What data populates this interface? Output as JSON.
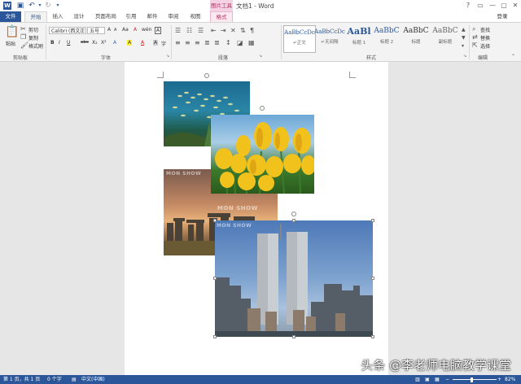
{
  "titlebar": {
    "doc_title": "文档1 - Word",
    "contextual_group": "图片工具",
    "minimize": "—",
    "restore": "▢",
    "close": "✕",
    "help": "?"
  },
  "tabs": {
    "file": "文件",
    "home": "开始",
    "insert": "插入",
    "design": "设计",
    "layout": "页面布局",
    "references": "引用",
    "mailings": "邮件",
    "review": "审阅",
    "view": "视图",
    "format": "格式",
    "login": "登录"
  },
  "ribbon": {
    "clipboard": {
      "paste": "粘贴",
      "cut": "剪切",
      "copy": "复制",
      "format_painter": "格式刷",
      "label": "剪贴板"
    },
    "font": {
      "family": "Calibri (西文正",
      "size": "五号",
      "label": "字体",
      "bold": "B",
      "italic": "I",
      "underline": "U",
      "strike": "abc",
      "sub": "X₂",
      "sup": "X²",
      "grow": "A",
      "shrink": "A",
      "case": "Aa",
      "clear": "A",
      "phonetic": "wén",
      "border_char": "A",
      "highlight": "A",
      "color": "A",
      "shade": "A",
      "enclose": "字"
    },
    "paragraph": {
      "label": "段落"
    },
    "styles": {
      "label": "样式",
      "items": [
        {
          "sample": "AaBbCcDc",
          "name": "↵正文"
        },
        {
          "sample": "AaBbCcDc",
          "name": "↵无间隔"
        },
        {
          "sample": "AaBl",
          "name": "标题 1"
        },
        {
          "sample": "AaBbC",
          "name": "标题 2"
        },
        {
          "sample": "AaBbC",
          "name": "标题"
        },
        {
          "sample": "AaBbC",
          "name": "副标题"
        }
      ]
    },
    "editing": {
      "label": "编辑",
      "find": "查找",
      "replace": "替换",
      "select": "选择"
    }
  },
  "document": {
    "watermark_1": "MON SHOW",
    "watermark_2": "MON SHOW",
    "watermark_3": "MON SHOW"
  },
  "status": {
    "page": "第 1 页，共 1 页",
    "words": "0 个字",
    "language": "中文(中国)",
    "zoom": "82%"
  },
  "overlay_text": "头条 @李老师电脑教学课堂",
  "colors": {
    "accent": "#2b579a",
    "picture_tools": "#b3325f"
  }
}
